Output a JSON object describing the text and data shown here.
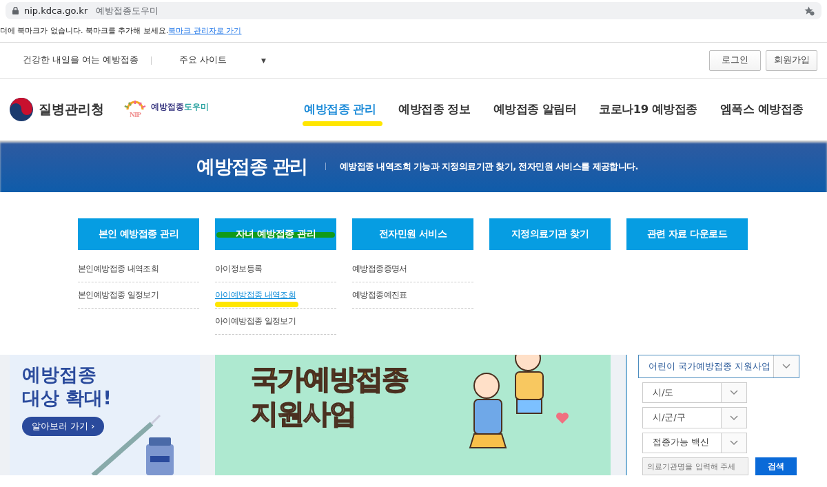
{
  "browser": {
    "url": "nip.kdca.go.kr",
    "page_title": "예방접종도우미",
    "bookmark_message": "더에 북마크가 없습니다. 북마크를 추가해 보세요.",
    "bookmark_link": "북마크 관리자로 가기"
  },
  "top_bar": {
    "tagline": "건강한 내일을 여는 예방접종",
    "sites_label": "주요 사이트",
    "sites_caret": "▼",
    "buttons": [
      "로그인",
      "회원가입"
    ]
  },
  "header": {
    "agency_name": "질병관리청",
    "nip_letters": "NIP",
    "nip_name_main": "예방접종",
    "nip_name_accent": "도우미",
    "nav": [
      {
        "label": "예방접종 관리",
        "selected": true,
        "color": "#ffe600"
      },
      {
        "label": "예방접종 정보",
        "selected": false
      },
      {
        "label": "예방접종 알림터",
        "selected": false
      },
      {
        "label": "코로나19 예방접종",
        "selected": false
      },
      {
        "label": "엠폭스 예방접종",
        "selected": false
      }
    ]
  },
  "banner": {
    "title": "예방접종 관리",
    "description": "예방접종 내역조회 기능과 지정의료기관 찾기, 전자민원 서비스를 제공합니다."
  },
  "menu_columns": [
    {
      "title": "본인 예방접종 관리",
      "items": [
        {
          "label": "본인예방접종 내역조회",
          "selected": false
        },
        {
          "label": "본인예방접종 일정보기",
          "selected": false
        }
      ]
    },
    {
      "title": "자녀 예방접종 관리",
      "color": "#129a0e",
      "items": [
        {
          "label": "아이정보등록",
          "selected": false
        },
        {
          "label": "아이예방접종 내역조회",
          "selected": true,
          "color": "#ffe600"
        },
        {
          "label": "아이예방접종 일정보기",
          "selected": false
        }
      ]
    },
    {
      "title": "전자민원 서비스",
      "items": [
        {
          "label": "예방접종증명서",
          "selected": false
        },
        {
          "label": "예방접종예진표",
          "selected": false
        }
      ]
    },
    {
      "title": "지정의료기관 찾기"
    },
    {
      "title": "관련 자료 다운로드"
    }
  ],
  "promo_left": {
    "headline_1": "예방접종",
    "headline_2": "대상 확대!",
    "button": "알아보러 가기 ›"
  },
  "promo_center": {
    "headline_1": "국가예방접종",
    "headline_2": "지원사업"
  },
  "search_panel": {
    "program_select": "어린이 국가예방접종 지원사업",
    "selects": [
      "시/도",
      "시/군/구",
      "접종가능 백신"
    ],
    "placeholder": "의료기관명을 입력해 주세",
    "button": "검색"
  }
}
